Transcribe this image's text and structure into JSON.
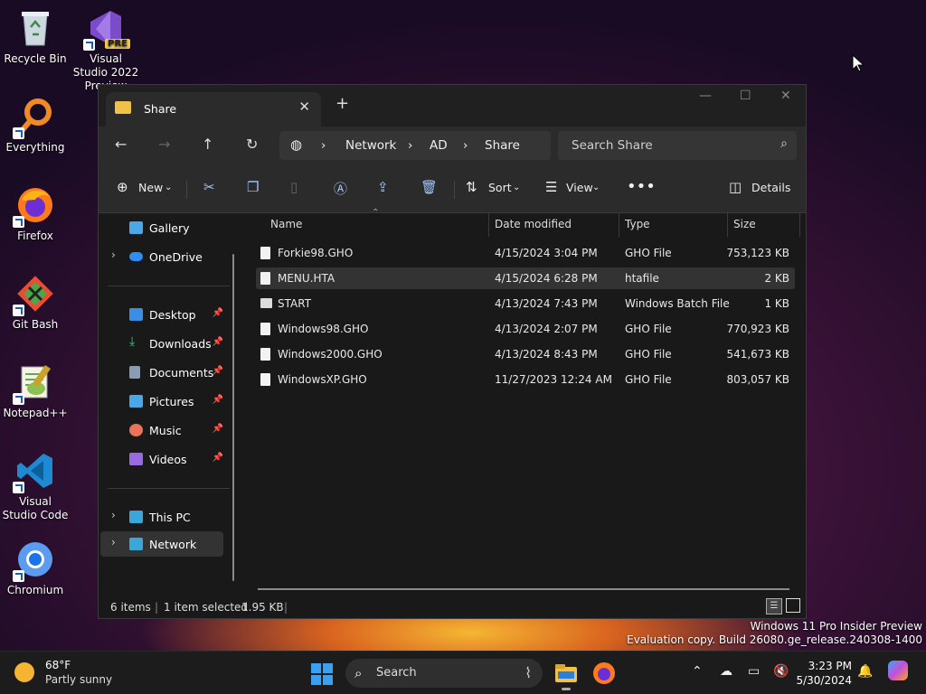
{
  "desktop": {
    "icons": [
      {
        "label": "Recycle Bin"
      },
      {
        "label": "Visual Studio 2022 Preview",
        "badge": "PRE"
      },
      {
        "label": "Everything"
      },
      {
        "label": "Firefox"
      },
      {
        "label": "Git Bash"
      },
      {
        "label": "Notepad++"
      },
      {
        "label": "Visual Studio Code"
      },
      {
        "label": "Chromium"
      }
    ]
  },
  "window": {
    "tab_title": "Share",
    "nav": {
      "crumbs": [
        "Network",
        "AD",
        "Share"
      ],
      "search_placeholder": "Search Share"
    },
    "commands": {
      "new": "New",
      "sort": "Sort",
      "view": "View",
      "details": "Details"
    },
    "sidebar": {
      "gallery": "Gallery",
      "onedrive": "OneDrive",
      "quick": [
        {
          "label": "Desktop",
          "color": "#3a8ee6"
        },
        {
          "label": "Downloads",
          "color": "#3fbf7f"
        },
        {
          "label": "Documents",
          "color": "#8a9bb3"
        },
        {
          "label": "Pictures",
          "color": "#4aa8e8"
        },
        {
          "label": "Music",
          "color": "#e8745a"
        },
        {
          "label": "Videos",
          "color": "#9b6ae0"
        }
      ],
      "this_pc": "This PC",
      "network": "Network"
    },
    "columns": {
      "name": "Name",
      "date": "Date modified",
      "type": "Type",
      "size": "Size"
    },
    "files": [
      {
        "name": "Forkie98.GHO",
        "date": "4/15/2024 3:04 PM",
        "type": "GHO File",
        "size": "753,123 KB"
      },
      {
        "name": "MENU.HTA",
        "date": "4/15/2024 6:28 PM",
        "type": "htafile",
        "size": "2 KB"
      },
      {
        "name": "START",
        "date": "4/13/2024 7:43 PM",
        "type": "Windows Batch File",
        "size": "1 KB"
      },
      {
        "name": "Windows98.GHO",
        "date": "4/13/2024 2:07 PM",
        "type": "GHO File",
        "size": "770,923 KB"
      },
      {
        "name": "Windows2000.GHO",
        "date": "4/13/2024 8:43 PM",
        "type": "GHO File",
        "size": "541,673 KB"
      },
      {
        "name": "WindowsXP.GHO",
        "date": "11/27/2023 12:24 AM",
        "type": "GHO File",
        "size": "803,057 KB"
      }
    ],
    "status": {
      "count": "6 items",
      "selected": "1 item selected",
      "size": "1.95 KB"
    }
  },
  "watermark": {
    "line1": "Windows 11 Pro Insider Preview",
    "line2": "Evaluation copy. Build 26080.ge_release.240308-1400"
  },
  "taskbar": {
    "weather_temp": "68°F",
    "weather_desc": "Partly sunny",
    "search": "Search",
    "time": "3:23 PM",
    "date": "5/30/2024"
  }
}
